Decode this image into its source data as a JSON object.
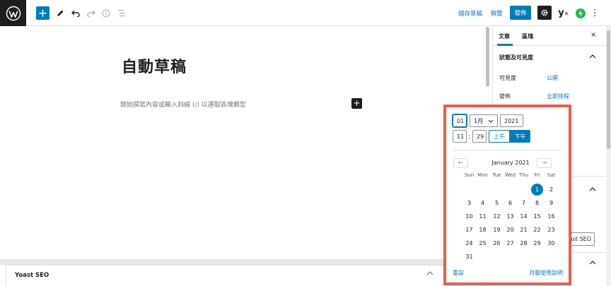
{
  "toolbar": {
    "save_draft": "儲存草稿",
    "preview": "預覽",
    "publish": "發佈",
    "plus": "+",
    "yoast_badge": "y",
    "more": "⋮"
  },
  "editor": {
    "title": "自動草稿",
    "placeholder": "開始撰寫內容或輸入斜線 (/) 以選取區塊類型",
    "inline_add": "+"
  },
  "sidebar": {
    "tabs": [
      "文章",
      "區塊"
    ],
    "close": "×",
    "section_title": "狀態及可見度",
    "rows": [
      {
        "label": "可見度",
        "value": "公開"
      },
      {
        "label": "發佈",
        "value": "立即排程"
      }
    ],
    "yoast_button": "ast SEO"
  },
  "meta_box": {
    "title": "Yoast SEO"
  },
  "date_picker": {
    "day": "01",
    "month": "1月",
    "year": "2021",
    "hour": "11",
    "minute": "29",
    "am": "上午",
    "pm": "下午",
    "prev": "←",
    "next": "→",
    "month_title": "January 2021",
    "weekdays": [
      "Sun",
      "Mon",
      "Tue",
      "Wed",
      "Thu",
      "Fri",
      "Sat"
    ],
    "first_weekday_index": 5,
    "days_in_month": 31,
    "selected_day": 1,
    "reset": "重設",
    "help": "月曆使用說明"
  },
  "colors": {
    "accent": "#007cba",
    "highlight_border": "#ef5a4c",
    "yoast_green": "#1db954"
  }
}
